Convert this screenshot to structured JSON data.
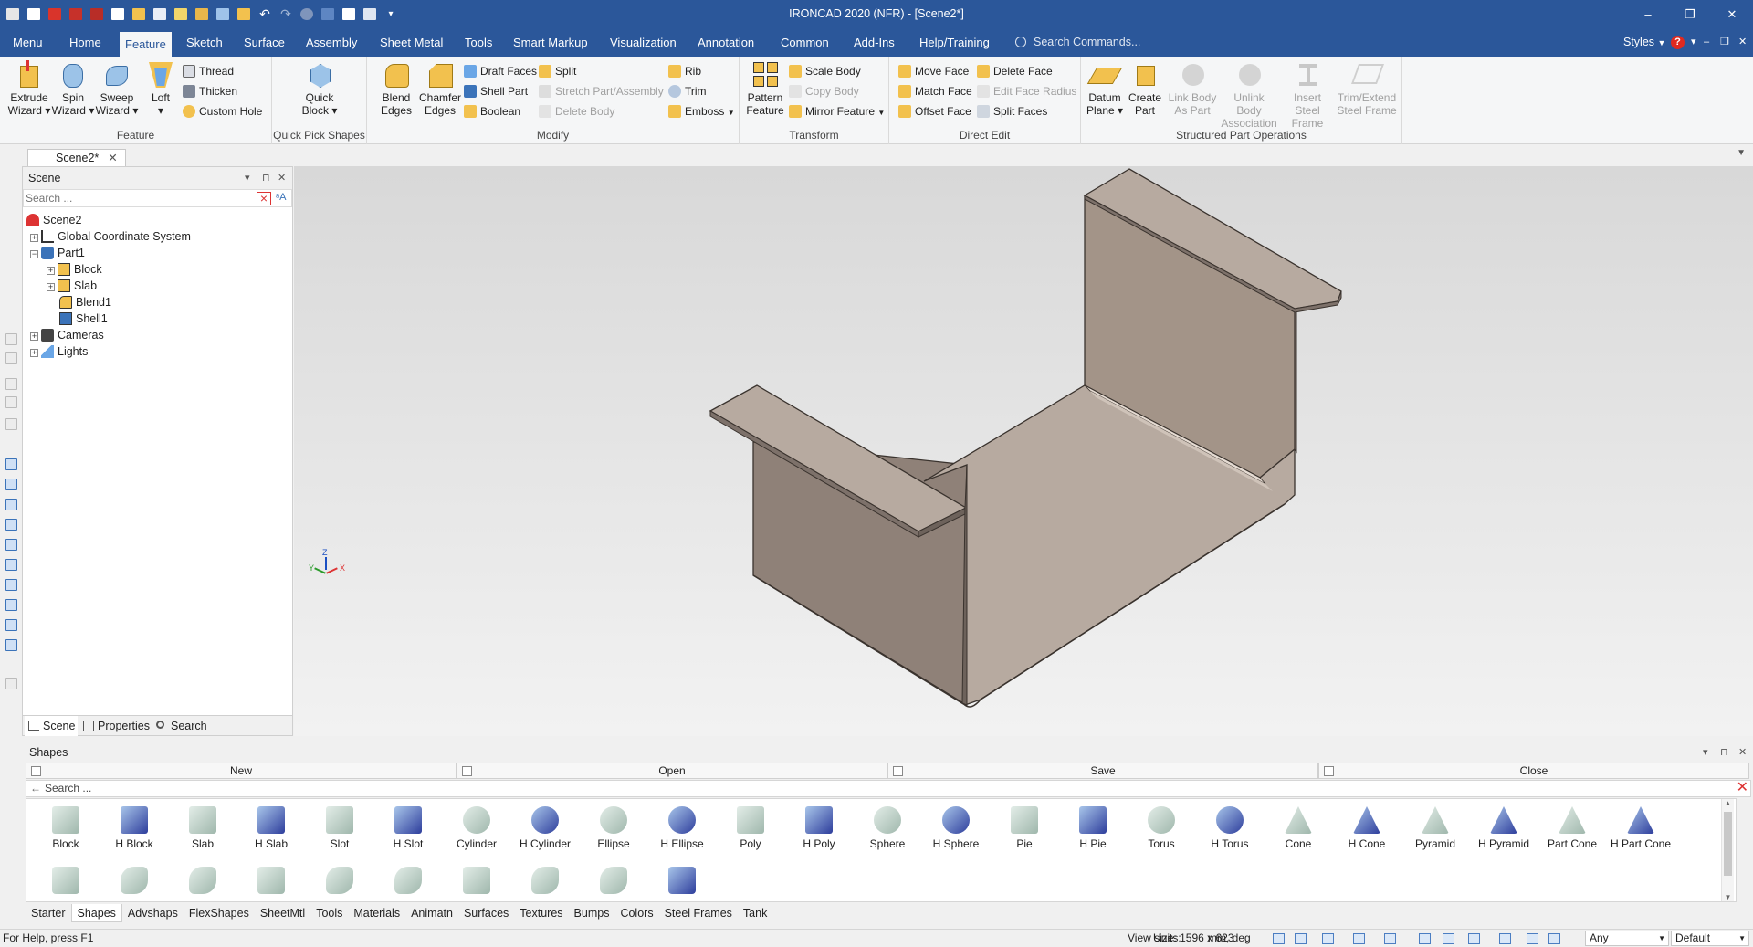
{
  "window": {
    "title": "IRONCAD 2020 (NFR) - [Scene2*]",
    "controls": [
      "–",
      "❐",
      "✕"
    ]
  },
  "ribbon_tabs": [
    "Menu",
    "Home",
    "Feature",
    "Sketch",
    "Surface",
    "Assembly",
    "Sheet Metal",
    "Tools",
    "Smart Markup",
    "Visualization",
    "Annotation",
    "Common",
    "Add-Ins",
    "Help/Training"
  ],
  "active_tab": "Feature",
  "command_search": {
    "placeholder": "Search Commands..."
  },
  "styles_label": "Styles",
  "help_glyph": "?",
  "ribbon": {
    "feature": {
      "label": "Feature",
      "extrude": "Extrude Wizard",
      "spin": "Spin Wizard",
      "sweep": "Sweep Wizard",
      "loft": "Loft",
      "thread": "Thread",
      "thicken": "Thicken",
      "custom_hole": "Custom Hole"
    },
    "quick_pick": {
      "label": "Quick Pick Shapes",
      "quick_block": "Quick Block"
    },
    "modify": {
      "label": "Modify",
      "blend": "Blend Edges",
      "chamfer": "Chamfer Edges",
      "draft_faces": "Draft Faces",
      "shell_part": "Shell Part",
      "boolean": "Boolean",
      "split": "Split",
      "stretch": "Stretch Part/Assembly",
      "delete_body": "Delete Body",
      "rib": "Rib",
      "trim": "Trim",
      "emboss": "Emboss"
    },
    "transform": {
      "label": "Transform",
      "pattern": "Pattern Feature",
      "scale": "Scale Body",
      "copy": "Copy Body",
      "mirror": "Mirror Feature"
    },
    "direct_edit": {
      "label": "Direct Edit",
      "move_face": "Move Face",
      "match_face": "Match Face",
      "offset_face": "Offset Face",
      "delete_face": "Delete Face",
      "edit_radius": "Edit Face Radius",
      "split_faces": "Split Faces"
    },
    "structured": {
      "label": "Structured Part Operations",
      "datum": "Datum Plane",
      "create_part": "Create Part",
      "link_body": "Link Body As Part",
      "unlink_body": "Unlink Body Association",
      "insert_steel": "Insert Steel Frame",
      "trim_extend": "Trim/Extend Steel Frame"
    }
  },
  "doc_tab": {
    "label": "Scene2*",
    "close": "✕"
  },
  "scene_panel": {
    "title": "Scene",
    "search_placeholder": "Search ...",
    "tree": [
      {
        "label": "Scene2",
        "level": 0,
        "expander": ""
      },
      {
        "label": "Global Coordinate System",
        "level": 1,
        "expander": "+"
      },
      {
        "label": "Part1",
        "level": 1,
        "expander": "−"
      },
      {
        "label": "Block",
        "level": 2,
        "expander": "+"
      },
      {
        "label": "Slab",
        "level": 2,
        "expander": "+"
      },
      {
        "label": "Blend1",
        "level": 2,
        "expander": ""
      },
      {
        "label": "Shell1",
        "level": 2,
        "expander": ""
      },
      {
        "label": "Cameras",
        "level": 1,
        "expander": "+"
      },
      {
        "label": "Lights",
        "level": 1,
        "expander": "+"
      }
    ],
    "tabs": [
      "Scene",
      "Properties",
      "Search"
    ]
  },
  "triad": {
    "z": "Z",
    "y": "Y",
    "x": "X"
  },
  "shapes_panel": {
    "title": "Shapes",
    "toolbar": [
      "New",
      "Open",
      "Save",
      "Close"
    ],
    "search_placeholder": "Search ...",
    "items": [
      "Block",
      "H Block",
      "Slab",
      "H Slab",
      "Slot",
      "H Slot",
      "Cylinder",
      "H Cylinder",
      "Ellipse",
      "H Ellipse",
      "Poly",
      "H Poly",
      "Sphere",
      "H Sphere",
      "Pie",
      "H Pie",
      "Torus",
      "H Torus",
      "Cone",
      "H Cone",
      "Pyramid",
      "H Pyramid",
      "Part Cone",
      "H Part Cone"
    ],
    "tabs": [
      "Starter",
      "Shapes",
      "Advshaps",
      "FlexShapes",
      "SheetMtl",
      "Tools",
      "Materials",
      "Animatn",
      "Surfaces",
      "Textures",
      "Bumps",
      "Colors",
      "Steel Frames",
      "Tank"
    ],
    "active_tab": "Shapes"
  },
  "status": {
    "help": "For Help, press F1",
    "view_size": "View size: 1596 x  623",
    "units_label": "Units:",
    "units_value": "mm, deg",
    "filter": "Any",
    "style": "Default"
  },
  "colors": {
    "title_blue": "#2b579a",
    "part_face": "#b7aaa0",
    "part_dark": "#8f8178",
    "part_light": "#c9bdb3"
  }
}
